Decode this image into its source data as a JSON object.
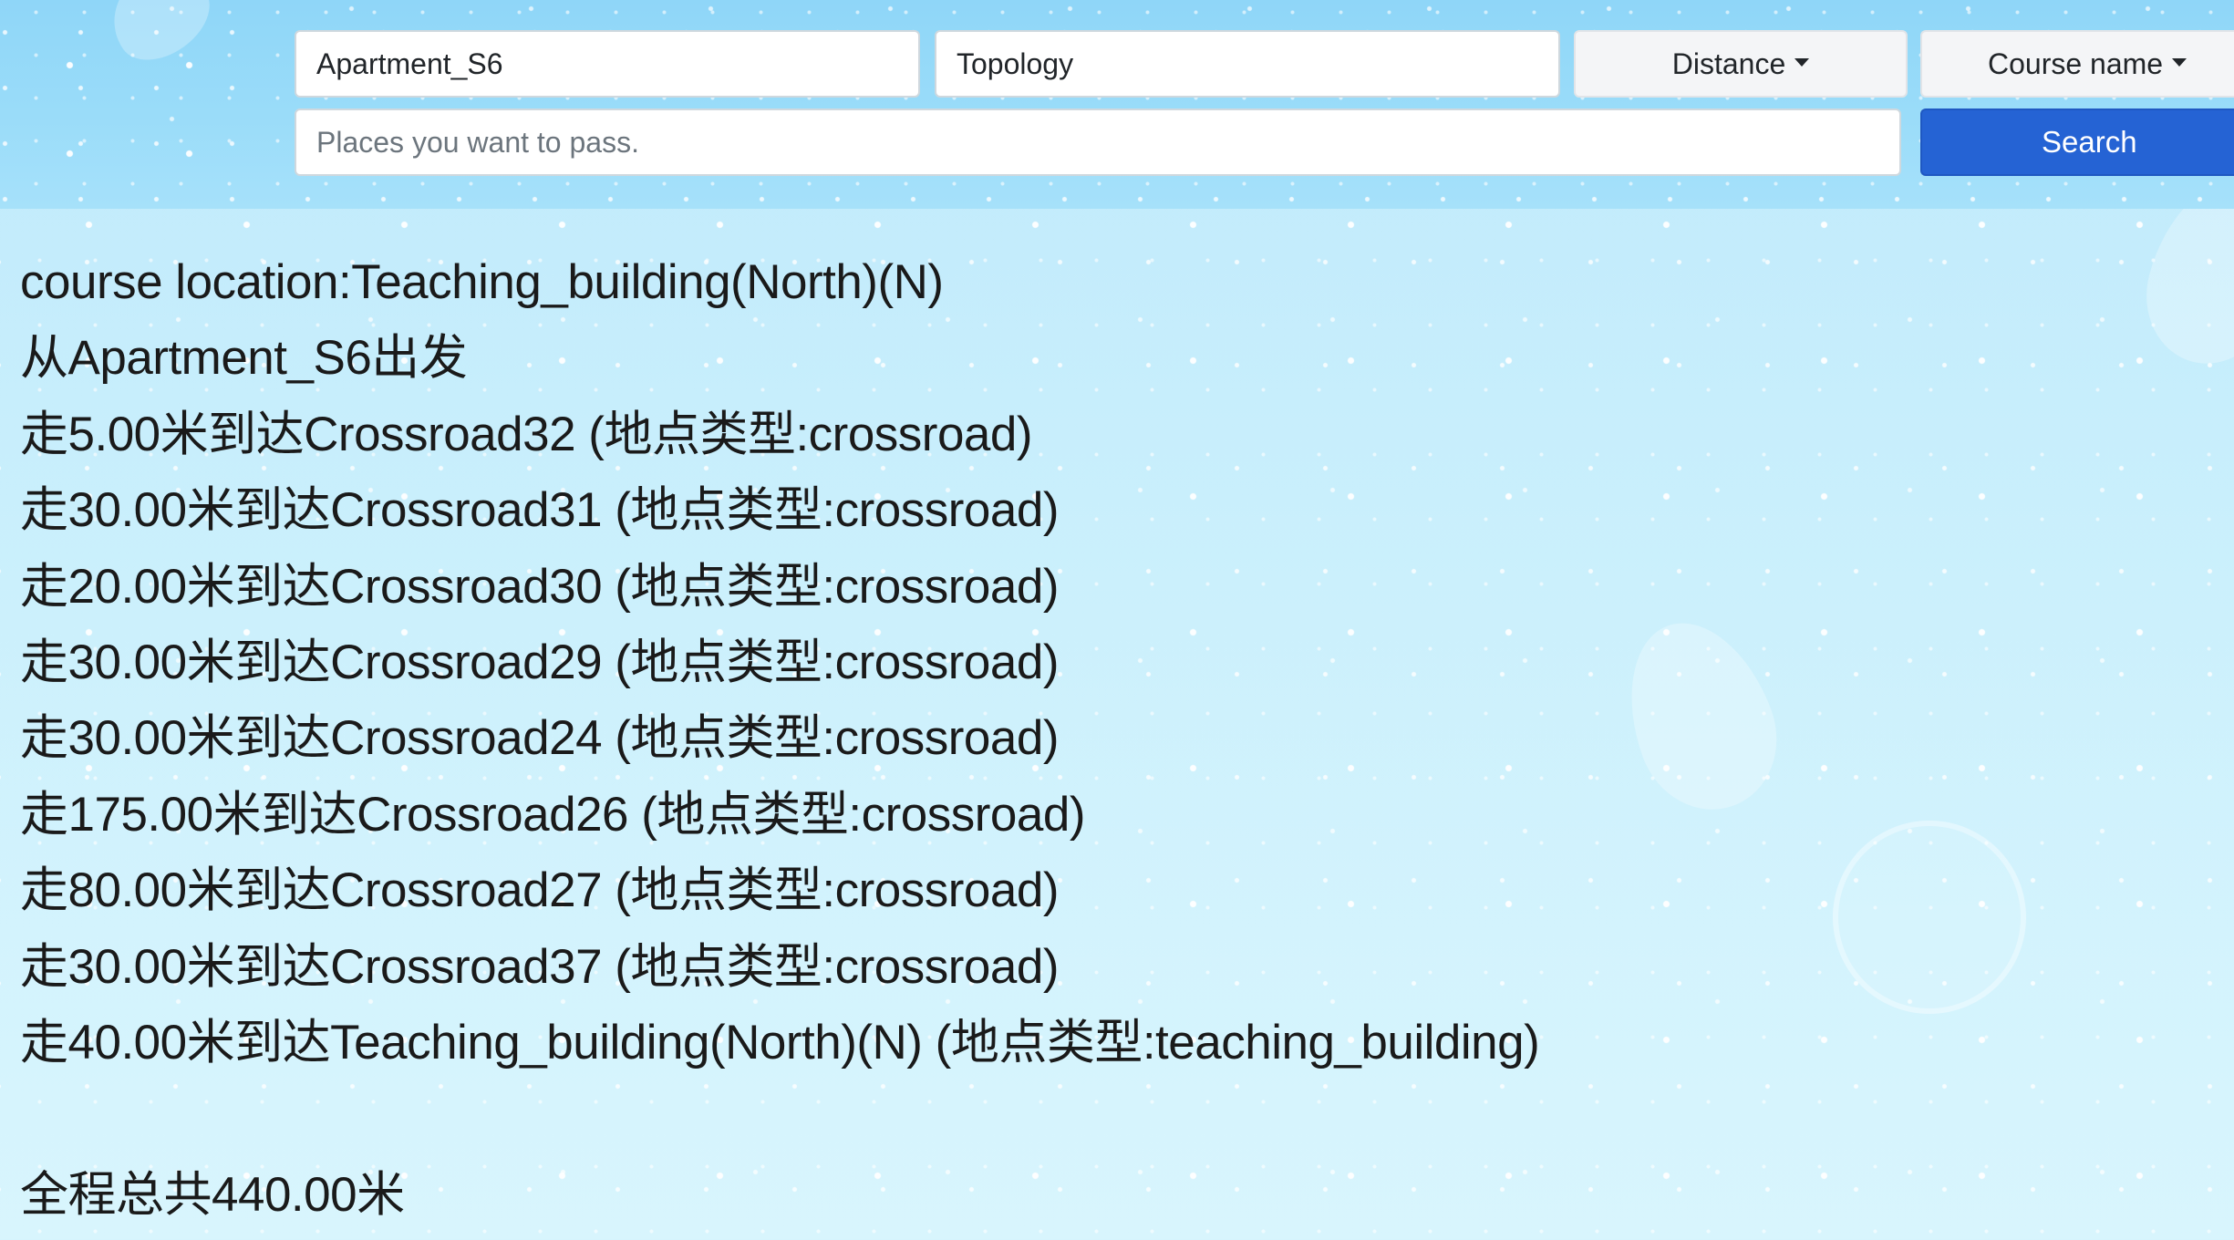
{
  "search_form": {
    "start_value": "Apartment_S6",
    "mode_value": "Topology",
    "strategy_label": "Distance",
    "query_type_label": "Course name",
    "waypoints_placeholder": "Places you want to pass.",
    "search_label": "Search"
  },
  "result": {
    "course_location": "course location:Teaching_building(North)(N)",
    "start_line": "从Apartment_S6出发",
    "steps": [
      "走5.00米到达Crossroad32 (地点类型:crossroad)",
      "走30.00米到达Crossroad31 (地点类型:crossroad)",
      "走20.00米到达Crossroad30 (地点类型:crossroad)",
      "走30.00米到达Crossroad29 (地点类型:crossroad)",
      "走30.00米到达Crossroad24 (地点类型:crossroad)",
      "走175.00米到达Crossroad26 (地点类型:crossroad)",
      "走80.00米到达Crossroad27 (地点类型:crossroad)",
      "走30.00米到达Crossroad37 (地点类型:crossroad)",
      "走40.00米到达Teaching_building(North)(N) (地点类型:teaching_building)"
    ],
    "total": "全程总共440.00米"
  },
  "colors": {
    "header_bg": "#9adcf9",
    "page_bg": "#c9effc",
    "primary_button": "#2563d4"
  }
}
